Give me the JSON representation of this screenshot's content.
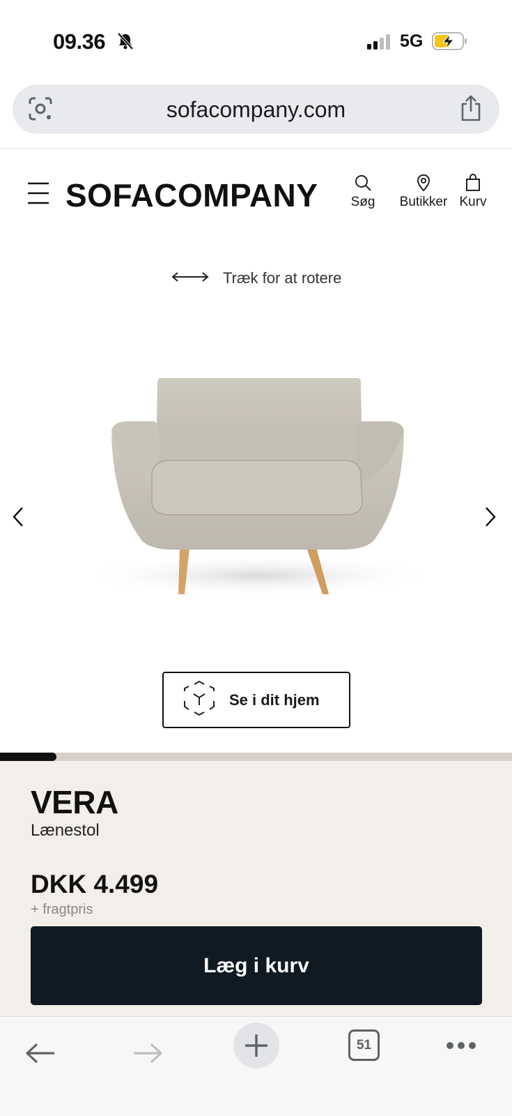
{
  "status_bar": {
    "time": "09.36",
    "network": "5G",
    "icons": [
      "bell-slash-icon",
      "signal-icon",
      "battery-charging-icon"
    ]
  },
  "browser": {
    "url": "sofacompany.com",
    "icons": [
      "google-lens-icon",
      "share-icon"
    ]
  },
  "header": {
    "logo": "SOFACOMPANY",
    "search_label": "Søg",
    "stores_label": "Butikker",
    "cart_label": "Kurv"
  },
  "viewer": {
    "rotate_hint": "Træk for at rotere",
    "ar_button_label": "Se i dit hjem",
    "gallery_progress": 0.11
  },
  "product": {
    "name": "VERA",
    "category": "Lænestol",
    "price": "DKK 4.499",
    "freight_note": "+ fragtpris",
    "add_to_cart_label": "Læg i kurv"
  },
  "bottom_toolbar": {
    "tab_count": "51"
  },
  "colors": {
    "brand_dark": "#0f1a22",
    "panel_bg": "#f2efeb",
    "progress_track": "#d6cec8",
    "sofa_fabric": "#c8c3b8",
    "wood_legs": "#d3a46a"
  }
}
